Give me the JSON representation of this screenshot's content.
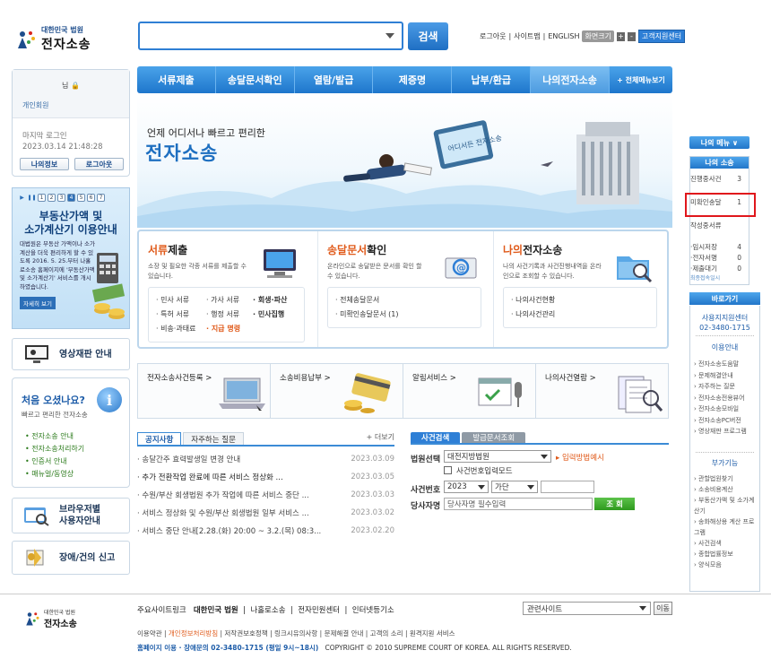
{
  "header": {
    "logo_small": "대한민국 법원",
    "logo_big": "전자소송",
    "search": {
      "value": "",
      "button": "검색"
    },
    "links": [
      "로그아웃",
      "사이트맵",
      "ENGLISH"
    ],
    "font_size_label": "화면크기",
    "support_center": "고객지원센터"
  },
  "nav": {
    "items": [
      "서류제출",
      "송달문서확인",
      "열람/발급",
      "제증명",
      "납부/환급",
      "나의전자소송"
    ],
    "all_menu": "+ 전체메뉴보기",
    "active_index": 5
  },
  "login": {
    "name_suffix": "님",
    "member_type": "개인회원",
    "last_login_label": "마지막 로그인",
    "last_login_time": "2023.03.14 21:48:28",
    "my_info": "나의정보",
    "logout": "로그아웃"
  },
  "banner": {
    "pages": [
      "1",
      "2",
      "3",
      "4",
      "5",
      "6",
      "7"
    ],
    "active_page": 4,
    "title1": "부동산가액 및",
    "title2": "소가계산기 이용안내",
    "body": "대법원은 부동산 가액이나 소가 계산을 더욱 편리하게 할 수 있도록 2016. 5. 25.부터 나홀로소송 홈페이지에 '부동산가액 및 소가계산기' 서비스를 개시하였습니다.",
    "more": "자세히 보기"
  },
  "left_buttons": {
    "video_trial": "영상재판 안내",
    "browser1": "브라우저별",
    "browser2": "사용자안내",
    "complaint": "장애/건의 신고"
  },
  "first_visit": {
    "question": "처음 오셨나요?",
    "sub": "빠르고 편리한 전자소송",
    "items": [
      "전자소송 안내",
      "전자소송처리하기",
      "인증서 안내",
      "매뉴얼/동영상"
    ]
  },
  "hero": {
    "subtitle": "언제 어디서나 빠르고 편리한",
    "title": "전자소송",
    "tablet_text": "어디서든 전자소송"
  },
  "services": [
    {
      "title_a": "서류",
      "title_b": "제출",
      "desc": "소장 및 필요한 각종 서류를 제출할 수 있습니다.",
      "items": [
        "· 민사 서류",
        "· 가사 서류",
        "· 회생·파산",
        "· 특허 서류",
        "· 행정 서류",
        "· 민사집행",
        "· 비송·과태료",
        "· 지급 명령",
        ""
      ]
    },
    {
      "title_a": "송달문서",
      "title_b": "확인",
      "desc": "온라인으로 송달받은 문서를 확인 할 수 있습니다.",
      "items": [
        "· 전체송달문서",
        "· 미확인송달문서 (1)"
      ]
    },
    {
      "title_a": "나의",
      "title_b": "전자소송",
      "desc": "나의 사건기록과 사건진행내역을 온라인으로 조회할 수 있습니다.",
      "items": [
        "· 나의사건현황",
        "· 나의사건관리"
      ]
    }
  ],
  "quick": [
    "전자소송사건등록 >",
    "소송비용납부 >",
    "알림서비스 >",
    "나의사건열람 >"
  ],
  "notices": {
    "tabs": [
      "공지사항",
      "자주하는 질문"
    ],
    "more": "+ 더보기",
    "rows": [
      {
        "title": "· 송달간주 효력발생일 변경 안내",
        "date": "2023.03.09"
      },
      {
        "title": "· 추가 전환작업 완료에 따른 서비스 정상화 ...",
        "date": "2023.03.05"
      },
      {
        "title": "· 수원/부산 회생법원 추가 작업에 따른 서비스 중단 ...",
        "date": "2023.03.03"
      },
      {
        "title": "· 서비스 정상화 및 수원/부산 회생법원 일부 서비스 ...",
        "date": "2023.03.02"
      },
      {
        "title": "· 서비스 중단 안내[2.28.(화) 20:00 ~ 3.2.(목) 08:3...",
        "date": "2023.02.20"
      }
    ]
  },
  "case_search": {
    "tabs": [
      "사건검색",
      "발급문서조회"
    ],
    "court_label": "법원선택",
    "court_value": "대전지방법원",
    "input_method": "▸ 입력방법예시",
    "checkbox": "사건번호입력모드",
    "case_no_label": "사건번호",
    "year": "2023",
    "type": "가단",
    "party_label": "당사자명",
    "party_placeholder": "당사자명 필수입력",
    "search_btn": "조 회"
  },
  "my_menu": {
    "button": "나의 메뉴 ∨",
    "header": "나의 소송",
    "rows": [
      {
        "label": "진행중사건",
        "count": "3"
      },
      {
        "label": "미확인송달",
        "count": "1"
      },
      {
        "label": "작성중서류",
        "count": ""
      },
      {
        "label": "·임시저장",
        "count": "4"
      },
      {
        "label": "·전자서명",
        "count": "0"
      },
      {
        "label": "·제출대기",
        "count": "0"
      }
    ],
    "footer": "최종접속일시"
  },
  "rail": {
    "title": "바로가기",
    "center": "사용지지원센터",
    "phone": "02-3480-1715",
    "usage_title": "이용안내",
    "usage": [
      "전자소송도움말",
      "문제해결안내",
      "자주하는 질문",
      "전자소송전용뷰어",
      "전자소송모바일",
      "전자소송PC버전",
      "영상재판 프로그램"
    ],
    "extra_title": "부가기능",
    "extra": [
      "관할법원찾기",
      "소송비용계산",
      "부동산가액 및 소가계산기",
      "송화해상용 계산 프로그램",
      "사건검색",
      "종합법률정보",
      "양식모음"
    ]
  },
  "footer": {
    "logo_small": "대한민국 법원",
    "logo_big": "전자소송",
    "links_label": "주요사이트링크",
    "links": [
      "대한민국 법원",
      "나홀로소송",
      "전자민원센터",
      "인터넷등기소"
    ],
    "related": "관련사이트",
    "go": "이동",
    "policy_a": "이용약관",
    "policy_b": "개인정보처리방침",
    "policy_rest": "저작권보호정책 | 링크시유의사항 | 문제해결 안내 | 고객의 소리 | 원격지원 서비스",
    "phone_line": "홈페이지 이용 · 장애문의 02-3480-1715 (평일 9시~18시)",
    "copyright": "COPYRIGHT © 2010 SUPREME COURT OF KOREA. ALL RIGHTS RESERVED."
  }
}
